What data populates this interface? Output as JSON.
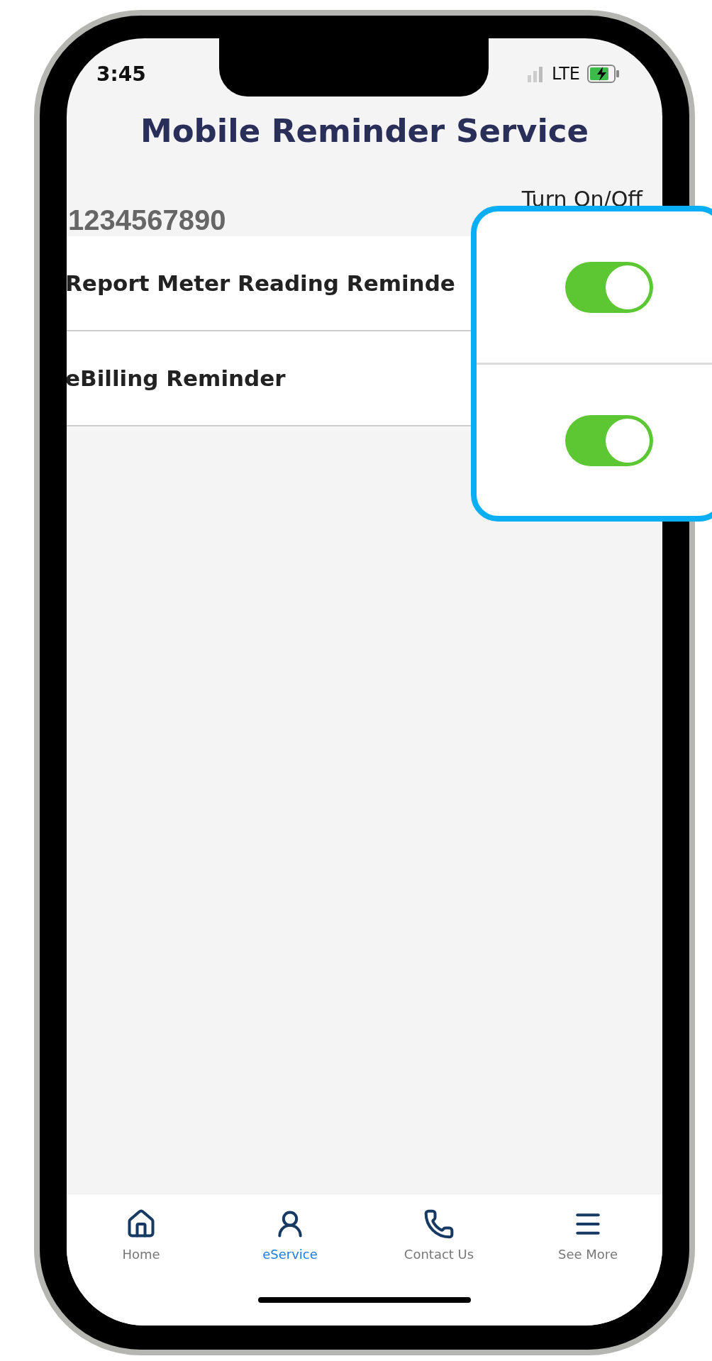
{
  "status_bar": {
    "time": "3:45",
    "network": "LTE"
  },
  "title": "Mobile Reminder Service",
  "account": {
    "number": "1234567890",
    "toggle_header": "Turn On/Off"
  },
  "reminders": [
    {
      "label": "Report Meter Reading Reminde",
      "on": true
    },
    {
      "label": "eBilling Reminder",
      "on": true
    }
  ],
  "nav": [
    {
      "label": "Home",
      "selected": false
    },
    {
      "label": "eService",
      "selected": true
    },
    {
      "label": "Contact Us",
      "selected": false
    },
    {
      "label": "See More",
      "selected": false
    }
  ]
}
